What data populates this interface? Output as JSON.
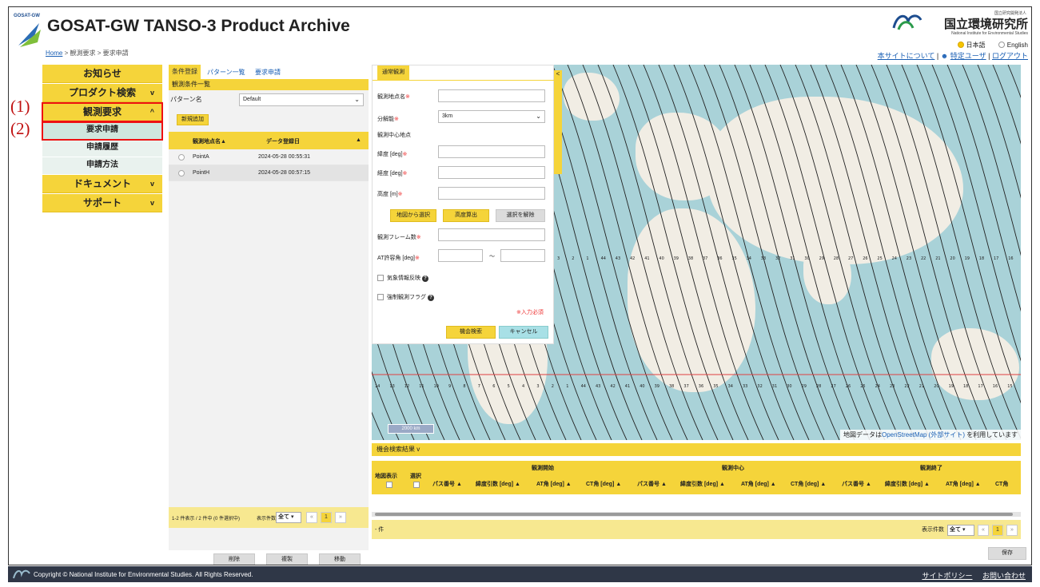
{
  "header": {
    "logo_small": "GOSAT-GW",
    "title": "GOSAT-GW TANSO-3 Product Archive",
    "breadcrumb": {
      "home": "Home",
      "sep": ">",
      "level1": "観測要求",
      "level2": "要求申請"
    },
    "institute": {
      "small": "国立研究開発法人",
      "name": "国立環境研究所",
      "en": "National Institute for Environmental Studies"
    },
    "lang": {
      "ja": "日本語",
      "en": "English",
      "selected": "ja"
    },
    "links": {
      "about": "本サイトについて",
      "specific_user": "特定ユーザ",
      "logout": "ログアウト",
      "sep": "|"
    }
  },
  "sidebar": {
    "items": [
      {
        "label": "お知らせ",
        "chevron": ""
      },
      {
        "label": "プロダクト検索",
        "chevron": "v"
      },
      {
        "label": "観測要求",
        "chevron": "^"
      },
      {
        "label": "ドキュメント",
        "chevron": "v"
      },
      {
        "label": "サポート",
        "chevron": "v"
      }
    ],
    "sub_items": [
      {
        "label": "要求申請",
        "active": true
      },
      {
        "label": "申請履歴",
        "active": false
      },
      {
        "label": "申請方法",
        "active": false
      }
    ],
    "markers": [
      "(1)",
      "(2)"
    ]
  },
  "conditions": {
    "tabs": [
      "条件登録",
      "パターン一覧",
      "要求申請"
    ],
    "section_title": "観測条件一覧",
    "pattern_label": "パターン名",
    "pattern_value": "Default",
    "add_button": "新規追加",
    "table": {
      "col_name": "観測地点名▲",
      "col_date": "データ登録日",
      "sort_icon": "▲",
      "rows": [
        {
          "name": "PointA",
          "date": "2024-05-28 00:55:31"
        },
        {
          "name": "PointH",
          "date": "2024-05-28 00:57:15"
        }
      ]
    },
    "pager": {
      "summary": "1-2 件表示 / 2 件中 (0 件選択中)",
      "per_page_label": "表示件数",
      "per_page_value": "全て",
      "page": "1",
      "prev": "«",
      "next": "»"
    },
    "buttons": {
      "delete": "削除",
      "copy": "複製",
      "move": "移動"
    }
  },
  "form": {
    "tab": "通常観測",
    "fields": {
      "site_name": "観測地点名",
      "resolution": "分解能",
      "resolution_value": "3km",
      "center_heading": "観測中心地点",
      "latitude": "緯度 [deg]",
      "longitude": "経度 [deg]",
      "altitude": "高度 [m]",
      "frame_count": "観測フレーム数",
      "at_angle": "AT許容角 [deg]",
      "range_sep": "〜",
      "weather_reflect": "気象情報反映",
      "forced_flag": "強制観測フラグ",
      "required_note": "※入力必須",
      "required_mark": "※"
    },
    "buttons": {
      "from_map": "地図から選択",
      "calc_altitude": "高度算出",
      "clear_selection": "選択を解除",
      "search": "機会検索",
      "cancel": "キャンセル"
    }
  },
  "map": {
    "scale": "2000 km",
    "attribution_prefix": "地図データは",
    "attribution_link": "OpenStreetMap (外部サイト)",
    "attribution_suffix": " を利用しています",
    "collapse": "<",
    "path_labels_top": [
      "3",
      "2",
      "1",
      "44",
      "43",
      "42",
      "41",
      "40",
      "39",
      "38",
      "37",
      "36",
      "35",
      "34",
      "33",
      "32",
      "31",
      "30",
      "29",
      "28",
      "27",
      "26",
      "25",
      "24",
      "23",
      "22",
      "21",
      "20",
      "19",
      "18",
      "17",
      "16"
    ],
    "path_labels_bottom": [
      "14",
      "13",
      "12",
      "11",
      "10",
      "9",
      "8",
      "7",
      "6",
      "5",
      "4",
      "3",
      "2",
      "1",
      "44",
      "43",
      "42",
      "41",
      "40",
      "39",
      "38",
      "37",
      "36",
      "35",
      "34",
      "33",
      "32",
      "31",
      "30",
      "29",
      "28",
      "27",
      "26",
      "25",
      "24",
      "23",
      "22",
      "21",
      "20",
      "19",
      "18",
      "17",
      "16",
      "15"
    ]
  },
  "results": {
    "title": "機会検索結果",
    "title_chevron": "v",
    "col_map": "地図表示",
    "col_select": "選択",
    "groups": [
      "観測開始",
      "観測中心",
      "観測終了"
    ],
    "sub_cols": [
      "パス番号 ▲",
      "緯度引数 [deg] ▲",
      "AT角 [deg] ▲",
      "CT角 [deg] ▲",
      "パス番号 ▲",
      "緯度引数 [deg] ▲",
      "AT角 [deg] ▲",
      "CT角 [deg] ▲",
      "パス番号 ▲",
      "緯度引数 [deg] ▲",
      "AT角 [deg] ▲",
      "CT角"
    ],
    "count": "- 件",
    "per_page_label": "表示件数",
    "per_page_value": "全て",
    "page": "1",
    "save": "保存"
  },
  "footer": {
    "copyright": "Copyright © National Institute for Environmental Studies. All Rights Reserved.",
    "policy": "サイトポリシー",
    "contact": "お問い合わせ"
  }
}
